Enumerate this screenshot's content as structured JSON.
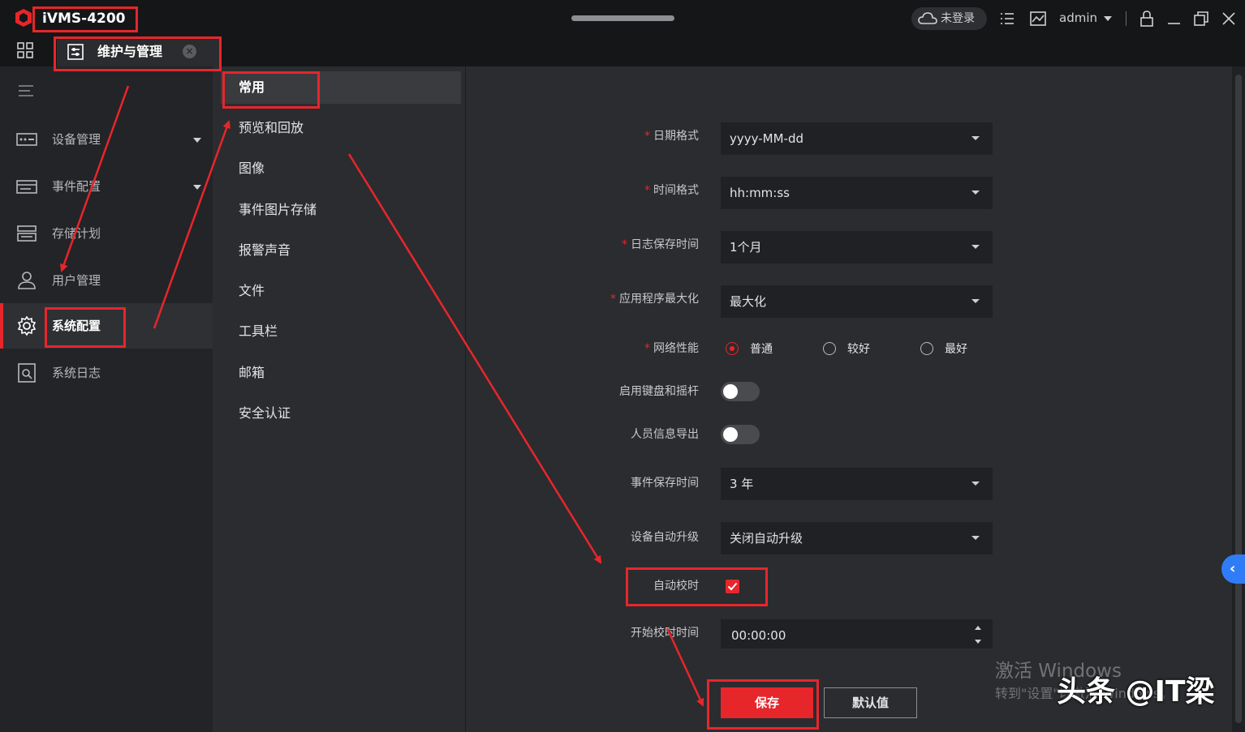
{
  "titlebar": {
    "app_title": "iVMS-4200",
    "login_status": "未登录",
    "user": "admin",
    "icons": [
      "cloud-icon",
      "list-icon",
      "monitor-icon",
      "lock-icon",
      "minimize-icon",
      "restore-icon",
      "close-icon"
    ]
  },
  "page_tab": {
    "label": "维护与管理",
    "close_symbol": "×"
  },
  "leftnav": {
    "items": [
      {
        "label": "设备管理",
        "icon": "device-icon"
      },
      {
        "label": "事件配置",
        "icon": "event-icon"
      },
      {
        "label": "存储计划",
        "icon": "storage-icon"
      },
      {
        "label": "用户管理",
        "icon": "user-icon"
      },
      {
        "label": "系统配置",
        "icon": "gear-icon"
      },
      {
        "label": "系统日志",
        "icon": "log-icon"
      }
    ],
    "active": "系统配置"
  },
  "submenu": {
    "items": [
      "常用",
      "预览和回放",
      "图像",
      "事件图片存储",
      "报警声音",
      "文件",
      "工具栏",
      "邮箱",
      "安全认证"
    ],
    "active": "常用"
  },
  "form": {
    "date_format": {
      "label": "日期格式",
      "value": "yyyy-MM-dd",
      "required": true
    },
    "time_format": {
      "label": "时间格式",
      "value": "hh:mm:ss",
      "required": true
    },
    "log_retention": {
      "label": "日志保存时间",
      "value": "1个月",
      "required": true
    },
    "app_maximize": {
      "label": "应用程序最大化",
      "value": "最大化",
      "required": true
    },
    "network": {
      "label": "网络性能",
      "required": true,
      "options": [
        "普通",
        "较好",
        "最好"
      ],
      "selected": "普通"
    },
    "keyboard_joystick": {
      "label": "启用键盘和摇杆",
      "on": false
    },
    "personnel_export": {
      "label": "人员信息导出",
      "on": false
    },
    "event_retention": {
      "label": "事件保存时间",
      "value": "3 年"
    },
    "auto_upgrade": {
      "label": "设备自动升级",
      "value": "关闭自动升级"
    },
    "auto_time_sync": {
      "label": "自动校时",
      "checked": true
    },
    "sync_start_time": {
      "label": "开始校时时间",
      "value": "00:00:00"
    }
  },
  "buttons": {
    "save": "保存",
    "default": "默认值"
  },
  "side_handle": "‹",
  "watermark": {
    "line1": "激活 Windows",
    "line2": "转到\"设置\"以激活 Windows。",
    "brand": "头条 @IT梁"
  },
  "colors": {
    "accent": "#e7262b",
    "background": "#2b2c2f",
    "titlebar": "#151618",
    "sidebar": "#232427",
    "input": "#202124",
    "handle": "#2f7cf6"
  }
}
